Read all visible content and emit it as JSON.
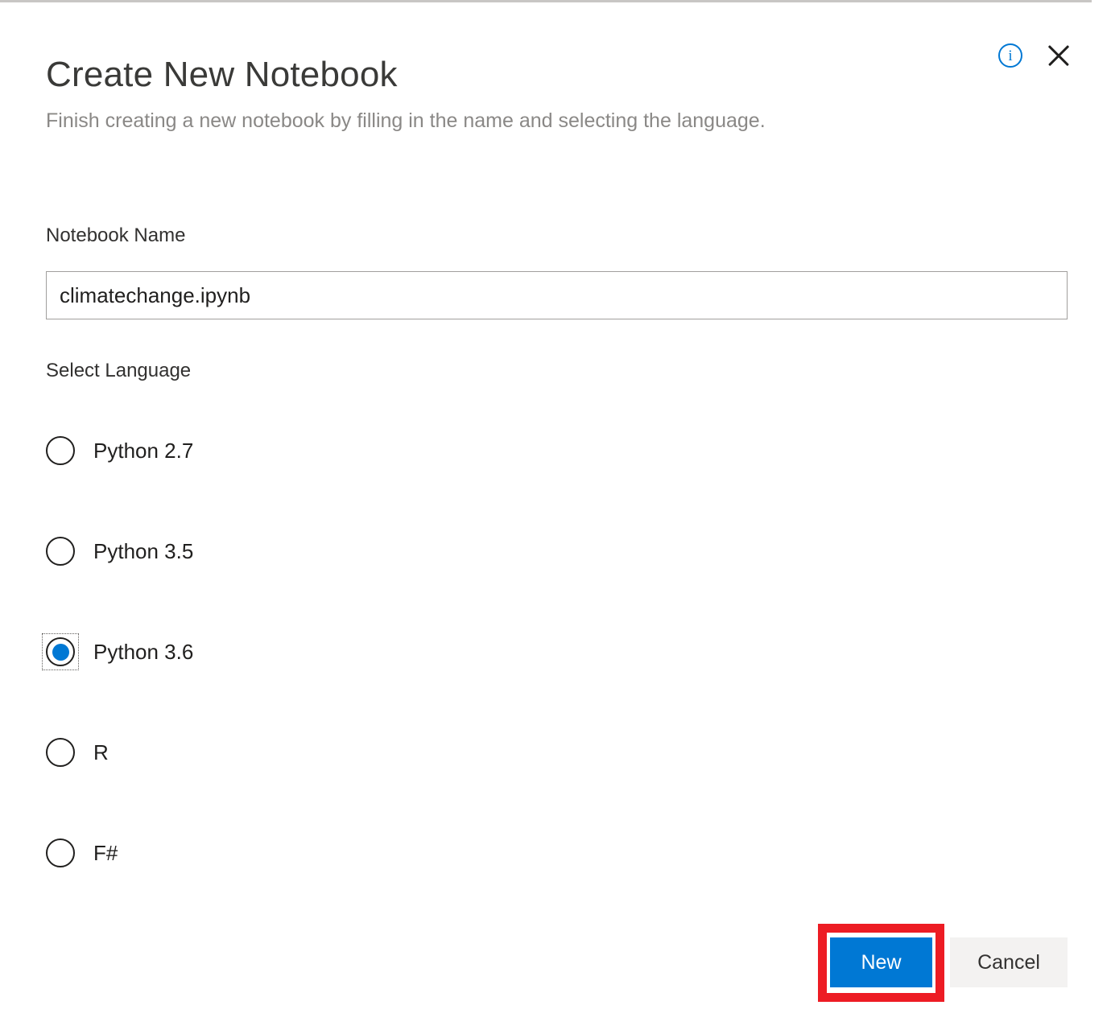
{
  "dialog": {
    "title": "Create New Notebook",
    "subtitle": "Finish creating a new notebook by filling in the name and selecting the language.",
    "info_icon": "info-icon",
    "info_glyph": "i",
    "close_icon": "close-icon"
  },
  "form": {
    "notebook_name": {
      "label": "Notebook Name",
      "value": "climatechange.ipynb",
      "placeholder": ""
    },
    "language": {
      "label": "Select Language",
      "selected": "Python 3.6",
      "options": [
        {
          "label": "Python 2.7",
          "selected": false
        },
        {
          "label": "Python 3.5",
          "selected": false
        },
        {
          "label": "Python 3.6",
          "selected": true
        },
        {
          "label": "R",
          "selected": false
        },
        {
          "label": "F#",
          "selected": false
        }
      ]
    }
  },
  "footer": {
    "new_label": "New",
    "cancel_label": "Cancel"
  },
  "colors": {
    "accent": "#0078d4",
    "annotation": "#ed1c24",
    "cancel_bg": "#f3f2f1",
    "border": "#a19f9d",
    "subtitle_text": "#8a8886",
    "primary_text": "#323130"
  }
}
